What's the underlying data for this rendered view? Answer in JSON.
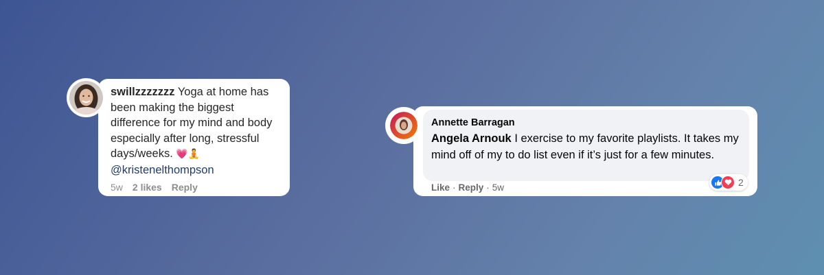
{
  "instagram_comment": {
    "username": "swillzzzzzzz",
    "text": "Yoga at home has been making the biggest difference for my mind and body especially after long, stressful days/weeks.",
    "emoji_heart": "💗",
    "emoji_yoga": "🧘",
    "mention": "@kristenelthompson",
    "age": "5w",
    "likes": "2 likes",
    "reply_label": "Reply"
  },
  "facebook_comment": {
    "author": "Annette Barragan",
    "tagged_user": "Angela Arnouk",
    "text": "I exercise to my favorite playlists. It takes my mind off of my to do list even if it’s just for a few minutes.",
    "like_label": "Like",
    "reply_label": "Reply",
    "age": "5w",
    "reaction_count": "2",
    "reactions": [
      "like-icon",
      "love-icon"
    ]
  },
  "colors": {
    "background_start": "#3d5593",
    "background_end": "#5e8fb0",
    "instagram_link": "#1f3d6b",
    "facebook_like": "#1877f2",
    "facebook_love": "#f33e58"
  }
}
